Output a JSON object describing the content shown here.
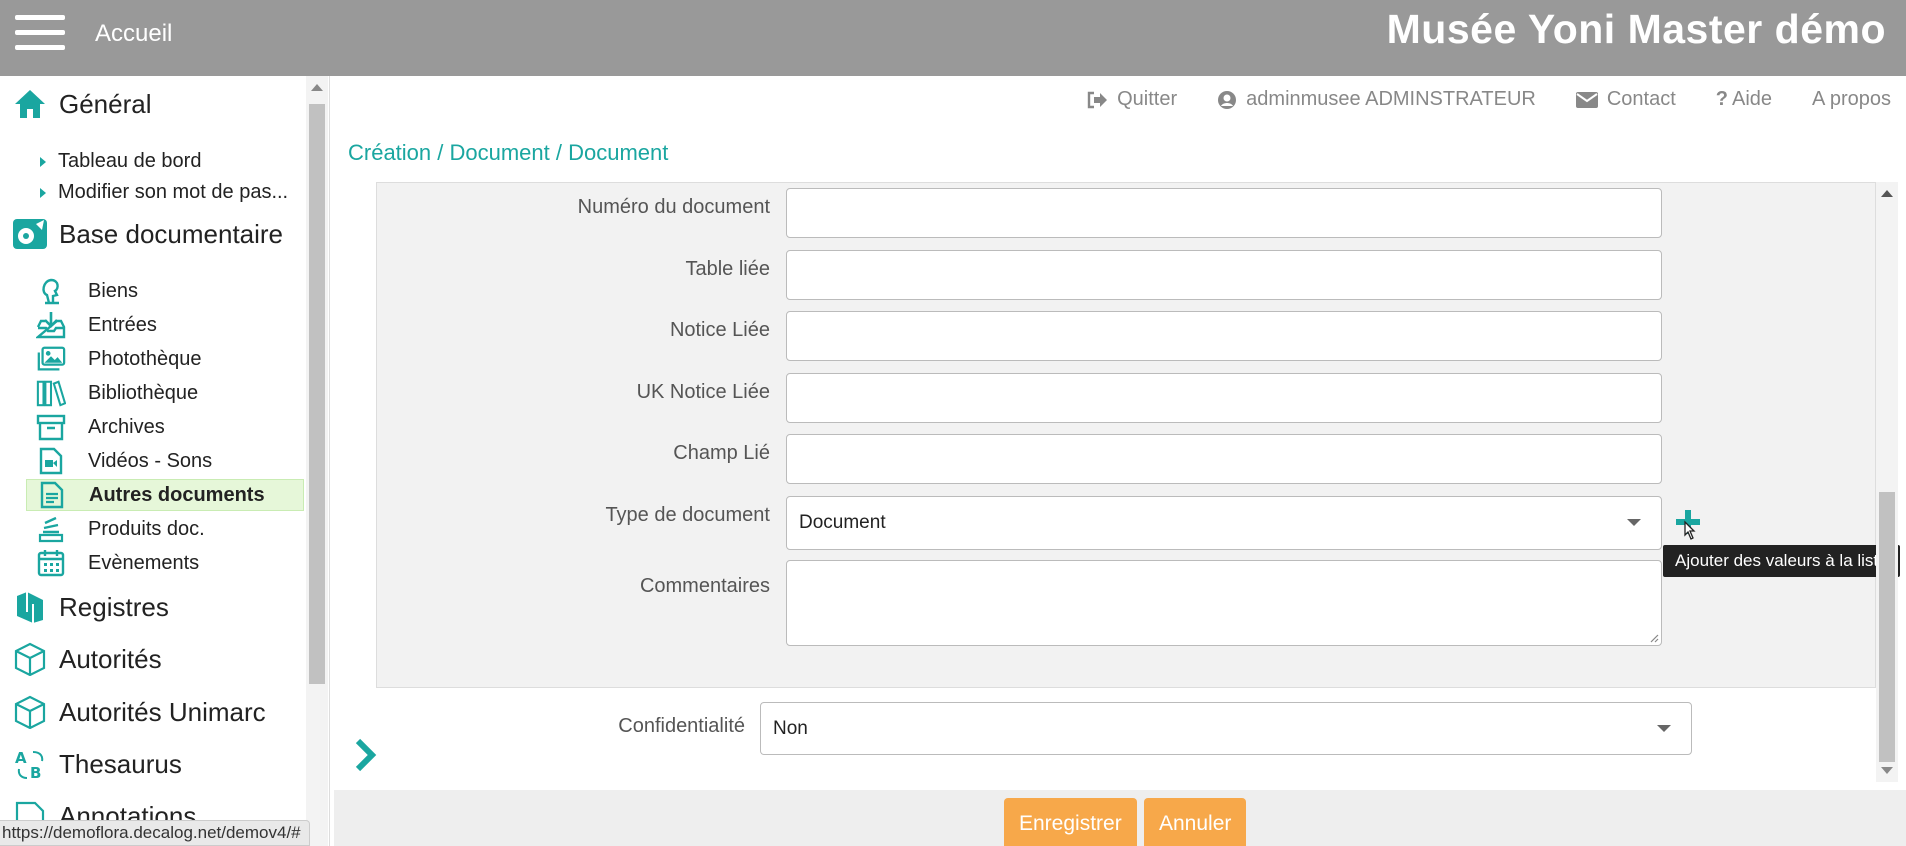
{
  "header": {
    "home_label": "Accueil",
    "site_title": "Musée Yoni Master démo"
  },
  "topnav": {
    "quit": "Quitter",
    "user": "adminmusee ADMINSTRATEUR",
    "contact": "Contact",
    "help": "Aide",
    "about": "A propos"
  },
  "breadcrumb": "Création / Document / Document",
  "sidebar": {
    "general": {
      "label": "Général",
      "items": [
        "Tableau de bord",
        "Modifier son mot de pas..."
      ]
    },
    "base": {
      "label": "Base documentaire",
      "items": [
        "Biens",
        "Entrées",
        "Photothèque",
        "Bibliothèque",
        "Archives",
        "Vidéos - Sons",
        "Autres documents",
        "Produits doc.",
        "Evènements"
      ]
    },
    "registres": "Registres",
    "autorites": "Autorités",
    "autorites_unimarc": "Autorités Unimarc",
    "thesaurus": "Thesaurus",
    "annotations": "Annotations"
  },
  "form": {
    "numero_label": "Numéro du document",
    "numero_value": "",
    "table_label": "Table liée",
    "table_value": "",
    "notice_label": "Notice Liée",
    "notice_value": "",
    "uk_notice_label": "UK Notice Liée",
    "uk_notice_value": "",
    "champ_label": "Champ Lié",
    "champ_value": "",
    "type_label": "Type de document",
    "type_value": "Document",
    "commentaires_label": "Commentaires",
    "tooltip": "Ajouter des valeurs à la liste",
    "confidentialite_label": "Confidentialité",
    "confidentialite_value": "Non"
  },
  "buttons": {
    "save": "Enregistrer",
    "cancel": "Annuler"
  },
  "statusbar_url": "https://demoflora.decalog.net/demov4/#",
  "colors": {
    "accent": "#1aa6a0",
    "header": "#999999",
    "button": "#f7a84a",
    "active_item": "#e6f7d9"
  }
}
